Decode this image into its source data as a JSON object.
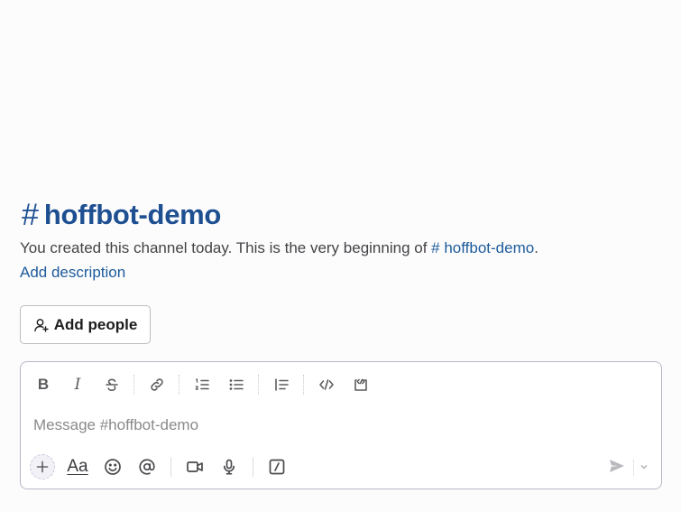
{
  "channel": {
    "hash": "#",
    "name": "hoffbot-demo"
  },
  "intro": {
    "text": "You created this channel today. This is the very beginning of ",
    "channel_ref": "# hoffbot-demo",
    "suffix": ".",
    "add_description": "Add description"
  },
  "add_people_button": {
    "label": "Add people"
  },
  "composer": {
    "placeholder": "Message #hoffbot-demo",
    "value": "",
    "toolbar": [
      "bold-icon",
      "italic-icon",
      "strikethrough-icon",
      "link-icon",
      "ordered-list-icon",
      "bulleted-list-icon",
      "blockquote-icon",
      "code-icon",
      "code-block-icon"
    ],
    "bottom_actions": [
      "plus-icon",
      "formatting-icon",
      "emoji-icon",
      "mention-icon",
      "video-icon",
      "microphone-icon",
      "slash-command-icon"
    ],
    "formatting_label": "Aa",
    "toolbar_labels": {
      "bold": "B",
      "italic": "I"
    }
  },
  "colors": {
    "accent": "#1d5b9a",
    "title": "#1d4f91",
    "background": "#fcfcfd"
  }
}
